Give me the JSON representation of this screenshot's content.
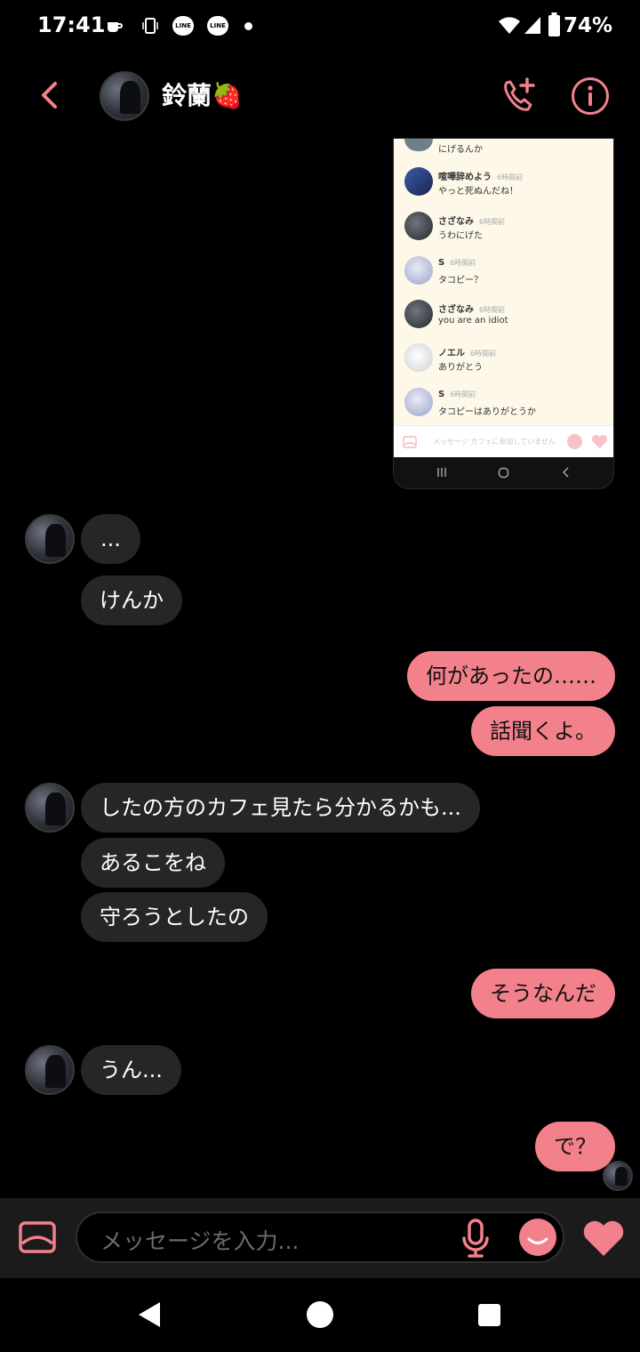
{
  "status": {
    "time": "17:41",
    "line1": "LINE",
    "line2": "LINE",
    "battery": "74%"
  },
  "header": {
    "name": "鈴蘭🍓"
  },
  "screenshot": {
    "top_partial": "にげるんか",
    "rows": [
      {
        "name": "喧嘩辞めよう",
        "time": "6時間前",
        "text": "やっと死ぬんだね！"
      },
      {
        "name": "さざなみ",
        "time": "6時間前",
        "text": "うわにげた"
      },
      {
        "name": "S",
        "time": "6時間前",
        "text": "タコピー？"
      },
      {
        "name": "さざなみ",
        "time": "6時間前",
        "text": "you are an idiot"
      },
      {
        "name": "ノエル",
        "time": "6時間前",
        "text": "ありがとう"
      },
      {
        "name": "S",
        "time": "6時間前",
        "text": "タコピーはありがとうか"
      }
    ],
    "input_placeholder": "メッセージ",
    "input_note": "カフェに参加していません"
  },
  "messages": {
    "m1": "...",
    "m2": "けんか",
    "m3": "何があったの……",
    "m4": "話聞くよ。",
    "m5": "したの方のカフェ見たら分かるかも...",
    "m6": "あるこをね",
    "m7": "守ろうとしたの",
    "m8": "そうなんだ",
    "m9": "うん...",
    "m10": "で？"
  },
  "composer": {
    "placeholder": "メッセージを入力..."
  },
  "colors": {
    "accent": "#f3818c",
    "received_bubble": "#262626",
    "background": "#000000"
  }
}
